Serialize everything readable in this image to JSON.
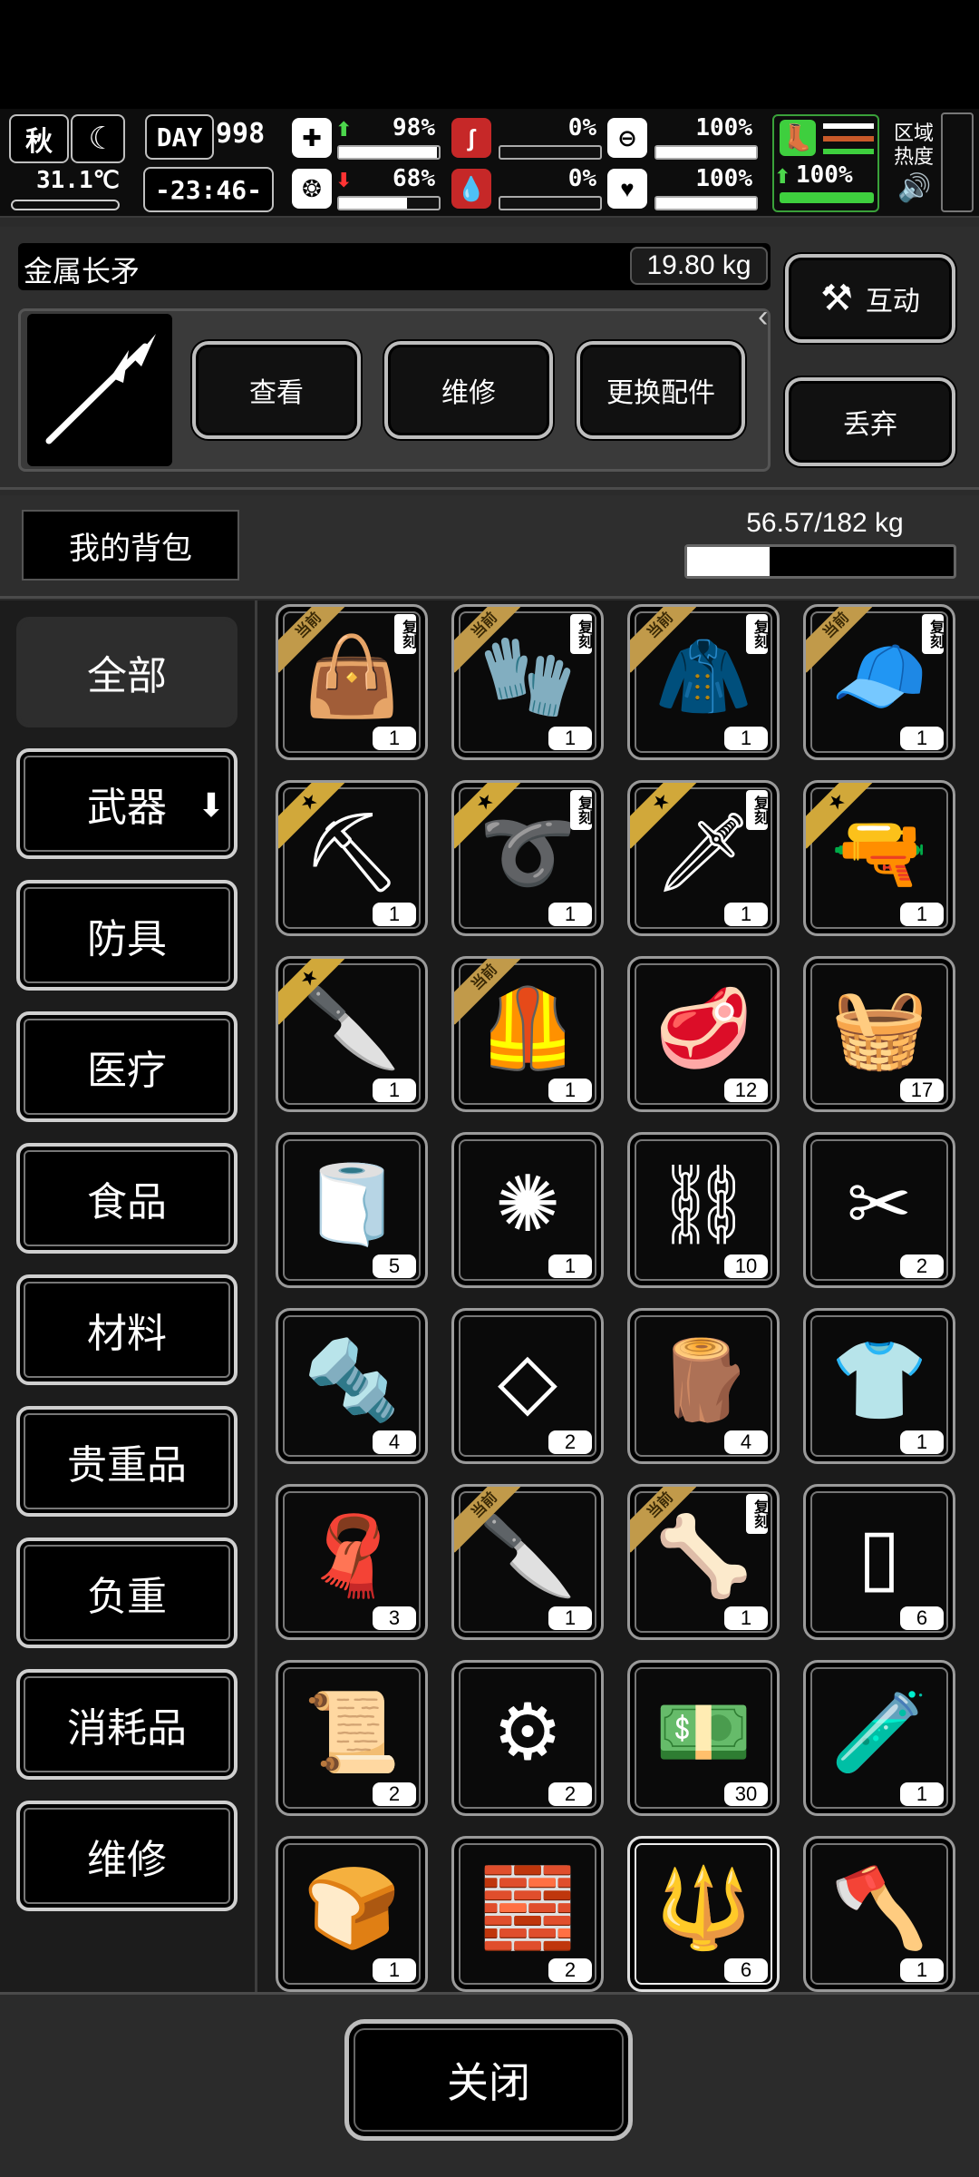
{
  "hud": {
    "season": "秋",
    "temperature": "31.1℃",
    "day_label": "DAY",
    "day_number": "998",
    "clock": "-23:46-",
    "stats": [
      {
        "icon": "medkit-icon",
        "value": "98%",
        "level": 0.98,
        "trend": "up"
      },
      {
        "icon": "stomach-icon",
        "value": "0%",
        "level": 0.0,
        "trend": ""
      },
      {
        "icon": "lungs-icon",
        "value": "100%",
        "level": 1.0,
        "trend": ""
      },
      {
        "icon": "brain-icon",
        "value": "68%",
        "level": 0.68,
        "trend": "down"
      },
      {
        "icon": "blood-drop-icon",
        "value": "0%",
        "level": 0.0,
        "trend": ""
      },
      {
        "icon": "heart-icon",
        "value": "100%",
        "level": 1.0,
        "trend": ""
      }
    ],
    "stamina": {
      "value": "100%",
      "level": 1.0
    },
    "zone_heat_label_1": "区域",
    "zone_heat_label_2": "热度"
  },
  "item": {
    "name": "金属长矛",
    "weight": "19.80 kg",
    "buttons": {
      "view": "查看",
      "repair": "维修",
      "swap_parts": "更换配件"
    },
    "interact": "互动",
    "discard": "丢弃"
  },
  "backpack": {
    "label": "我的背包",
    "capacity": "56.57/182 kg",
    "fill": 0.31
  },
  "categories": [
    "全部",
    "武器",
    "防具",
    "医疗",
    "食品",
    "材料",
    "贵重品",
    "负重",
    "消耗品",
    "维修"
  ],
  "active_category": "全部",
  "ribbon_text": "当前",
  "copy_tag": "复刻",
  "slots": [
    {
      "name": "bag",
      "glyph": "👜",
      "qty": "1",
      "ribbon": "current",
      "copy": true
    },
    {
      "name": "gloves",
      "glyph": "🧤",
      "qty": "1",
      "ribbon": "current",
      "copy": true
    },
    {
      "name": "jacket",
      "glyph": "🧥",
      "qty": "1",
      "ribbon": "current",
      "copy": true
    },
    {
      "name": "cap",
      "glyph": "🧢",
      "qty": "1",
      "ribbon": "current",
      "copy": true
    },
    {
      "name": "shovel",
      "glyph": "⛏",
      "qty": "1",
      "ribbon": "star",
      "copy": false
    },
    {
      "name": "whip",
      "glyph": "➰",
      "qty": "1",
      "ribbon": "star",
      "copy": true
    },
    {
      "name": "serpent-blade",
      "glyph": "🗡",
      "qty": "1",
      "ribbon": "star",
      "copy": true
    },
    {
      "name": "caulking-gun",
      "glyph": "🔫",
      "qty": "1",
      "ribbon": "star",
      "copy": false
    },
    {
      "name": "combat-knife",
      "glyph": "🔪",
      "qty": "1",
      "ribbon": "star",
      "copy": false
    },
    {
      "name": "vest",
      "glyph": "🦺",
      "qty": "1",
      "ribbon": "current",
      "copy": false
    },
    {
      "name": "meat",
      "glyph": "🥩",
      "qty": "12",
      "ribbon": "",
      "copy": false
    },
    {
      "name": "cloth-stack",
      "glyph": "🧺",
      "qty": "17",
      "ribbon": "",
      "copy": false
    },
    {
      "name": "rag",
      "glyph": "🧻",
      "qty": "5",
      "ribbon": "",
      "copy": false
    },
    {
      "name": "fiber",
      "glyph": "✺",
      "qty": "1",
      "ribbon": "",
      "copy": false
    },
    {
      "name": "scrap-metal",
      "glyph": "⛓",
      "qty": "10",
      "ribbon": "",
      "copy": false
    },
    {
      "name": "metal-pieces",
      "glyph": "✂",
      "qty": "2",
      "ribbon": "",
      "copy": false
    },
    {
      "name": "screws",
      "glyph": "🔩",
      "qty": "4",
      "ribbon": "",
      "copy": false
    },
    {
      "name": "glass-shards",
      "glyph": "◇",
      "qty": "2",
      "ribbon": "",
      "copy": false
    },
    {
      "name": "planks",
      "glyph": "🪵",
      "qty": "4",
      "ribbon": "",
      "copy": false
    },
    {
      "name": "torn-shirt",
      "glyph": "👕",
      "qty": "1",
      "ribbon": "",
      "copy": false
    },
    {
      "name": "towel",
      "glyph": "🧣",
      "qty": "3",
      "ribbon": "",
      "copy": false
    },
    {
      "name": "knife",
      "glyph": "🔪",
      "qty": "1",
      "ribbon": "current",
      "copy": false
    },
    {
      "name": "bone-whip",
      "glyph": "🦴",
      "qty": "1",
      "ribbon": "current",
      "copy": true
    },
    {
      "name": "blanket",
      "glyph": "▯",
      "qty": "6",
      "ribbon": "",
      "copy": false
    },
    {
      "name": "paper-roll",
      "glyph": "📜",
      "qty": "2",
      "ribbon": "",
      "copy": false
    },
    {
      "name": "parts",
      "glyph": "⚙",
      "qty": "2",
      "ribbon": "",
      "copy": false
    },
    {
      "name": "cash",
      "glyph": "💵",
      "qty": "30",
      "ribbon": "",
      "copy": false
    },
    {
      "name": "beaker",
      "glyph": "🧪",
      "qty": "1",
      "ribbon": "",
      "copy": false
    },
    {
      "name": "bread",
      "glyph": "🍞",
      "qty": "1",
      "ribbon": "",
      "copy": false
    },
    {
      "name": "brick",
      "glyph": "🧱",
      "qty": "2",
      "ribbon": "",
      "copy": false
    },
    {
      "name": "metal-spear",
      "glyph": "🔱",
      "qty": "6",
      "ribbon": "",
      "copy": false,
      "selected": true
    },
    {
      "name": "hatchet",
      "glyph": "🪓",
      "qty": "1",
      "ribbon": "",
      "copy": false
    }
  ],
  "close_label": "关闭"
}
